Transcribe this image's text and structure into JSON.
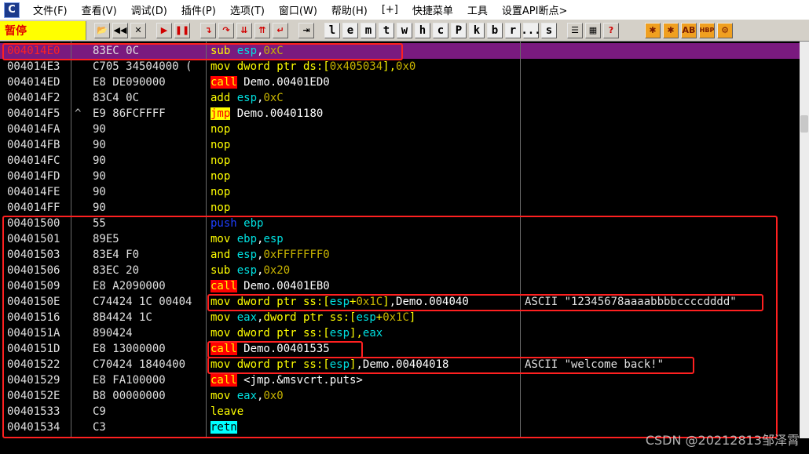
{
  "menu": [
    "文件(F)",
    "查看(V)",
    "调试(D)",
    "插件(P)",
    "选项(T)",
    "窗口(W)",
    "帮助(H)",
    "[+]",
    "快捷菜单",
    "工具",
    "设置API断点>"
  ],
  "app_icon": "C",
  "status": "暂停",
  "toolbar_letters": [
    "l",
    "e",
    "m",
    "t",
    "w",
    "h",
    "c",
    "P",
    "k",
    "b",
    "r",
    "...",
    "s"
  ],
  "toolbar_right": [
    "HBP"
  ],
  "rows": [
    {
      "addr": "004014E0",
      "mark": "",
      "hex": "83EC 0C",
      "asm": [
        [
          "sub ",
          "k-y"
        ],
        [
          "esp",
          "k-cy"
        ],
        [
          ",",
          "k-w"
        ],
        [
          "0xC",
          "k-num"
        ]
      ],
      "comment": ""
    },
    {
      "addr": "004014E3",
      "mark": "",
      "hex": "C705 34504000 (",
      "asm": [
        [
          "mov ",
          "k-y"
        ],
        [
          "dword ptr ds:[",
          "k-y"
        ],
        [
          "0x405034",
          "k-num"
        ],
        [
          "],",
          "k-y"
        ],
        [
          "0x0",
          "k-num"
        ]
      ],
      "comment": ""
    },
    {
      "addr": "004014ED",
      "mark": "",
      "hex": "E8 DE090000",
      "asm": [
        [
          "call",
          "k-call"
        ],
        [
          " Demo.00401ED0",
          "k-w"
        ]
      ],
      "comment": ""
    },
    {
      "addr": "004014F2",
      "mark": "",
      "hex": "83C4 0C",
      "asm": [
        [
          "add ",
          "k-y"
        ],
        [
          "esp",
          "k-cy"
        ],
        [
          ",",
          "k-w"
        ],
        [
          "0xC",
          "k-num"
        ]
      ],
      "comment": ""
    },
    {
      "addr": "004014F5",
      "mark": "^",
      "hex": "E9 86FCFFFF",
      "asm": [
        [
          "jmp",
          "k-jmp"
        ],
        [
          " Demo.00401180",
          "k-w"
        ]
      ],
      "comment": ""
    },
    {
      "addr": "004014FA",
      "mark": "",
      "hex": "90",
      "asm": [
        [
          "nop",
          "k-y"
        ]
      ],
      "comment": ""
    },
    {
      "addr": "004014FB",
      "mark": "",
      "hex": "90",
      "asm": [
        [
          "nop",
          "k-y"
        ]
      ],
      "comment": ""
    },
    {
      "addr": "004014FC",
      "mark": "",
      "hex": "90",
      "asm": [
        [
          "nop",
          "k-y"
        ]
      ],
      "comment": ""
    },
    {
      "addr": "004014FD",
      "mark": "",
      "hex": "90",
      "asm": [
        [
          "nop",
          "k-y"
        ]
      ],
      "comment": ""
    },
    {
      "addr": "004014FE",
      "mark": "",
      "hex": "90",
      "asm": [
        [
          "nop",
          "k-y"
        ]
      ],
      "comment": ""
    },
    {
      "addr": "004014FF",
      "mark": "",
      "hex": "90",
      "asm": [
        [
          "nop",
          "k-y"
        ]
      ],
      "comment": ""
    },
    {
      "addr": "00401500",
      "mark": "",
      "hex": "55",
      "asm": [
        [
          "push ",
          "k-push"
        ],
        [
          "ebp",
          "k-cy"
        ]
      ],
      "comment": ""
    },
    {
      "addr": "00401501",
      "mark": "",
      "hex": "89E5",
      "asm": [
        [
          "mov ",
          "k-y"
        ],
        [
          "ebp",
          "k-cy"
        ],
        [
          ",",
          "k-w"
        ],
        [
          "esp",
          "k-cy"
        ]
      ],
      "comment": ""
    },
    {
      "addr": "00401503",
      "mark": "",
      "hex": "83E4 F0",
      "asm": [
        [
          "and ",
          "k-y"
        ],
        [
          "esp",
          "k-cy"
        ],
        [
          ",",
          "k-w"
        ],
        [
          "0xFFFFFFF0",
          "k-num"
        ]
      ],
      "comment": ""
    },
    {
      "addr": "00401506",
      "mark": "",
      "hex": "83EC 20",
      "asm": [
        [
          "sub ",
          "k-y"
        ],
        [
          "esp",
          "k-cy"
        ],
        [
          ",",
          "k-w"
        ],
        [
          "0x20",
          "k-num"
        ]
      ],
      "comment": ""
    },
    {
      "addr": "00401509",
      "mark": "",
      "hex": "E8 A2090000",
      "asm": [
        [
          "call",
          "k-call"
        ],
        [
          " Demo.00401EB0",
          "k-w"
        ]
      ],
      "comment": ""
    },
    {
      "addr": "0040150E",
      "mark": "",
      "hex": "C74424 1C 00404",
      "asm": [
        [
          "mov ",
          "k-y"
        ],
        [
          "dword ptr ss:[",
          "k-y"
        ],
        [
          "esp",
          "k-cy"
        ],
        [
          "+",
          "k-y"
        ],
        [
          "0x1C",
          "k-num"
        ],
        [
          "]",
          "k-y"
        ],
        [
          ",Demo.004040",
          "k-w"
        ]
      ],
      "comment": "ASCII \"12345678aaaabbbbccccdddd\""
    },
    {
      "addr": "00401516",
      "mark": "",
      "hex": "8B4424 1C",
      "asm": [
        [
          "mov ",
          "k-y"
        ],
        [
          "eax",
          "k-cy"
        ],
        [
          ",",
          "k-w"
        ],
        [
          "dword ptr ss:[",
          "k-y"
        ],
        [
          "esp",
          "k-cy"
        ],
        [
          "+",
          "k-y"
        ],
        [
          "0x1C",
          "k-num"
        ],
        [
          "]",
          "k-y"
        ]
      ],
      "comment": ""
    },
    {
      "addr": "0040151A",
      "mark": "",
      "hex": "890424",
      "asm": [
        [
          "mov ",
          "k-y"
        ],
        [
          "dword ptr ss:[",
          "k-y"
        ],
        [
          "esp",
          "k-cy"
        ],
        [
          "],",
          "k-y"
        ],
        [
          "eax",
          "k-cy"
        ]
      ],
      "comment": ""
    },
    {
      "addr": "0040151D",
      "mark": "",
      "hex": "E8 13000000",
      "asm": [
        [
          "call",
          "k-call"
        ],
        [
          " Demo.00401535",
          "k-w"
        ]
      ],
      "comment": ""
    },
    {
      "addr": "00401522",
      "mark": "",
      "hex": "C70424 1840400",
      "asm": [
        [
          "mov ",
          "k-y"
        ],
        [
          "dword ptr ss:[",
          "k-y"
        ],
        [
          "esp",
          "k-cy"
        ],
        [
          "]",
          "k-y"
        ],
        [
          ",Demo.00404018",
          "k-w"
        ]
      ],
      "comment": "ASCII \"welcome back!\""
    },
    {
      "addr": "00401529",
      "mark": "",
      "hex": "E8 FA100000",
      "asm": [
        [
          "call",
          "k-call"
        ],
        [
          " <jmp.&msvcrt.puts>",
          "k-w"
        ]
      ],
      "comment": ""
    },
    {
      "addr": "0040152E",
      "mark": "",
      "hex": "B8 00000000",
      "asm": [
        [
          "mov ",
          "k-y"
        ],
        [
          "eax",
          "k-cy"
        ],
        [
          ",",
          "k-w"
        ],
        [
          "0x0",
          "k-num"
        ]
      ],
      "comment": ""
    },
    {
      "addr": "00401533",
      "mark": "",
      "hex": "C9",
      "asm": [
        [
          "leave",
          "k-y"
        ]
      ],
      "comment": ""
    },
    {
      "addr": "00401534",
      "mark": "",
      "hex": "C3",
      "asm": [
        [
          "retn",
          "k-retn"
        ]
      ],
      "comment": ""
    }
  ],
  "watermark": "CSDN @20212813邹泽霄"
}
